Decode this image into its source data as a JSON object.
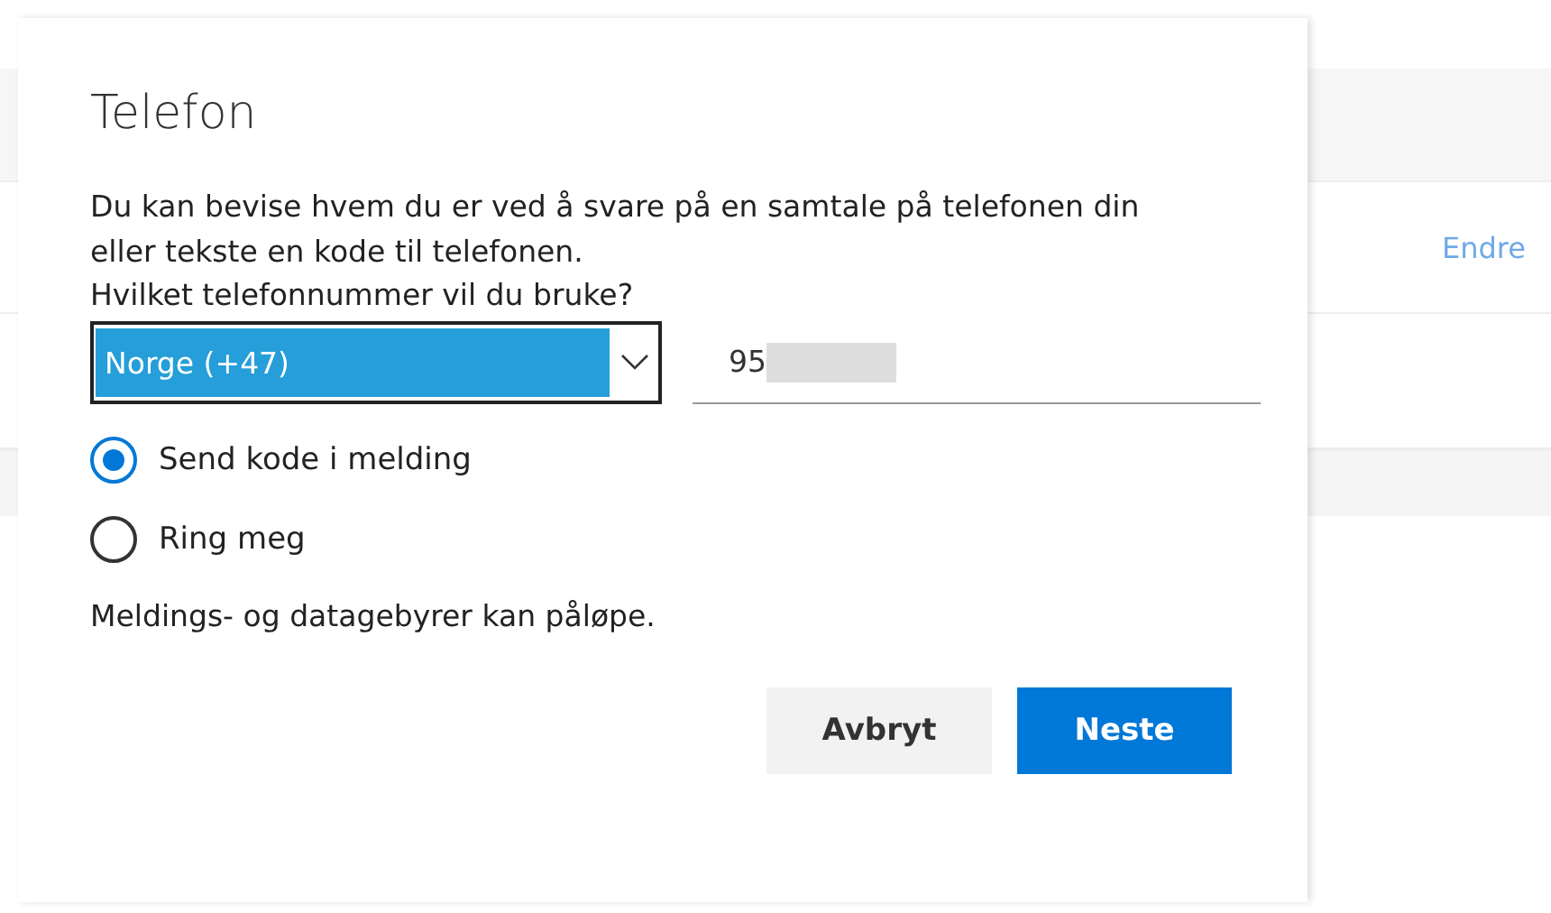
{
  "background": {
    "link": "Endre"
  },
  "dialog": {
    "title": "Telefon",
    "description": "Du kan bevise hvem du er ved å svare på en samtale på telefonen din eller tekste en kode til telefonen.",
    "question": "Hvilket telefonnummer vil du bruke?",
    "country_select": {
      "value": "Norge (+47)"
    },
    "phone_field": {
      "value": "95"
    },
    "options": [
      {
        "label": "Send kode i melding",
        "selected": true
      },
      {
        "label": "Ring meg",
        "selected": false
      }
    ],
    "note": "Meldings- og datagebyrer kan påløpe.",
    "buttons": [
      {
        "label": "Avbryt",
        "kind": "secondary"
      },
      {
        "label": "Neste",
        "kind": "primary"
      }
    ]
  }
}
